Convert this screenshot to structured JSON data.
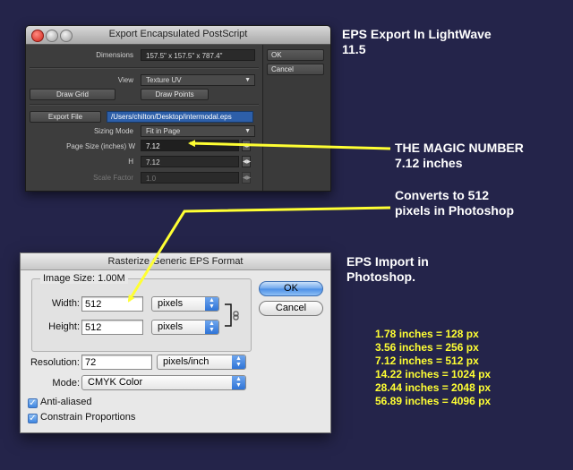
{
  "lightwave_dialog": {
    "title": "Export Encapsulated PostScript",
    "dimensions_label": "Dimensions",
    "dimensions_value": "157.5\" x 157.5\" x 787.4\"",
    "ok_label": "OK",
    "cancel_label": "Cancel",
    "view_label": "View",
    "view_value": "Texture UV",
    "draw_grid_label": "Draw Grid",
    "draw_points_label": "Draw Points",
    "export_file_label": "Export File",
    "export_file_path": "/Users/chilton/Desktop/intermodal.eps",
    "sizing_mode_label": "Sizing Mode",
    "sizing_mode_value": "Fit in Page",
    "page_size_w_label": "Page Size (inches) W",
    "page_size_w_value": "7.12",
    "h_label": "H",
    "h_value": "7.12",
    "scale_factor_label": "Scale Factor",
    "scale_factor_value": "1.0"
  },
  "photoshop_dialog": {
    "title": "Rasterize Generic EPS Format",
    "image_size_label": "Image Size: 1.00M",
    "width_label": "Width:",
    "width_value": "512",
    "width_unit": "pixels",
    "height_label": "Height:",
    "height_value": "512",
    "height_unit": "pixels",
    "resolution_label": "Resolution:",
    "resolution_value": "72",
    "resolution_unit": "pixels/inch",
    "mode_label": "Mode:",
    "mode_value": "CMYK Color",
    "ok_label": "OK",
    "cancel_label": "Cancel",
    "anti_aliased_label": "Anti-aliased",
    "anti_aliased_checked": true,
    "constrain_label": "Constrain Proportions",
    "constrain_checked": true
  },
  "annotations": {
    "eps_export_line1": "EPS Export In LightWave",
    "eps_export_line2": "11.5",
    "magic_line1": "THE MAGIC NUMBER",
    "magic_line2": "7.12 inches",
    "converts_line1": "Converts to 512",
    "converts_line2": "pixels in Photoshop",
    "eps_import_line1": "EPS Import in",
    "eps_import_line2": "Photoshop.",
    "arrow_color": "#ffff33"
  },
  "conversion_table": [
    "1.78 inches = 128 px",
    "3.56 inches = 256 px",
    "7.12 inches = 512 px",
    "14.22 inches = 1024 px",
    "28.44 inches = 2048 px",
    "56.89 inches = 4096 px"
  ]
}
